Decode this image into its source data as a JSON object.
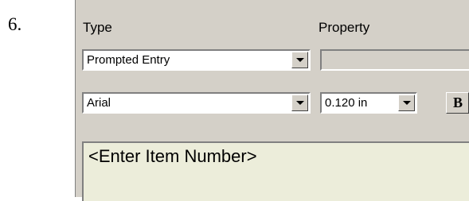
{
  "step_number": "6.",
  "labels": {
    "type": "Type",
    "property": "Property"
  },
  "type_select": {
    "value": "Prompted Entry"
  },
  "property_field": {
    "value": ""
  },
  "font_select": {
    "value": "Arial"
  },
  "size_select": {
    "value": "0.120 in"
  },
  "bold_button": {
    "label": "B"
  },
  "text_entry": {
    "value": "<Enter Item Number>"
  }
}
